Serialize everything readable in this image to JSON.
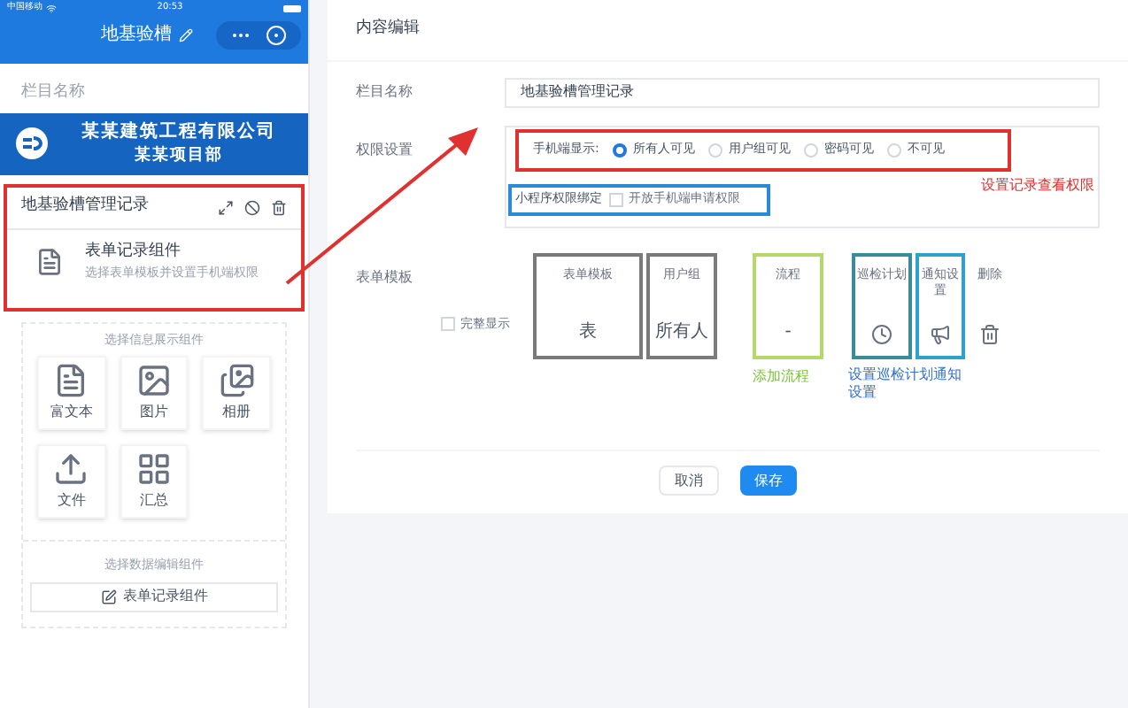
{
  "phone": {
    "carrier": "中国移动",
    "time": "20:53",
    "title": "地基验槽",
    "section_label": "栏目名称",
    "banner": {
      "company": "某某建筑工程有限公司",
      "department": "某某项目部"
    },
    "card": {
      "title": "地基验槽管理记录",
      "item_title": "表单记录组件",
      "item_subtitle": "选择表单模板并设置手机端权限"
    },
    "info_label": "选择信息展示组件",
    "widgets": [
      {
        "label": "富文本",
        "kind": "doc"
      },
      {
        "label": "图片",
        "kind": "image"
      },
      {
        "label": "相册",
        "kind": "album"
      },
      {
        "label": "文件",
        "kind": "upload"
      },
      {
        "label": "汇总",
        "kind": "grid"
      }
    ],
    "edit_label": "选择数据编辑组件",
    "edit_button": "表单记录组件"
  },
  "editor": {
    "title": "内容编辑",
    "name_label": "栏目名称",
    "name_value": "地基验槽管理记录",
    "permission_label": "权限设置",
    "display_label": "手机端显示:",
    "radios": [
      {
        "label": "所有人可见",
        "selected": true
      },
      {
        "label": "用户组可见",
        "selected": false
      },
      {
        "label": "密码可见",
        "selected": false
      },
      {
        "label": "不可见",
        "selected": false
      }
    ],
    "permission_note": "设置记录查看权限",
    "bind_label": "小程序权限绑定",
    "bind_option": {
      "label": "开放手机端申请权限",
      "checked": false
    },
    "form_label": "表单模板",
    "full_display": {
      "label": "完整显示",
      "checked": false
    },
    "columns": [
      {
        "label": "表单模板",
        "color": "#7a7a7a",
        "cell": {
          "kind": "text",
          "text": "表"
        }
      },
      {
        "label": "用户组",
        "color": "#7a7a7a",
        "cell": {
          "kind": "text",
          "text": "所有人"
        }
      },
      {
        "label": "流程",
        "color": "#b5d86a",
        "cell": {
          "kind": "text",
          "text": "-"
        }
      },
      {
        "label": "巡检计划",
        "color": "#3a8c9a",
        "cell": {
          "kind": "clock"
        }
      },
      {
        "label": "通知设置",
        "color": "#2fa3c7",
        "cell": {
          "kind": "megaphone"
        }
      },
      {
        "label": "删除",
        "cell": {
          "kind": "trash"
        }
      }
    ],
    "notes": [
      {
        "text": "添加流程",
        "color": "#7cc23a"
      },
      {
        "text": "设置巡检计划通知设置",
        "color": "#2f6fd0"
      }
    ],
    "buttons": [
      {
        "label": "取消",
        "kind": "secondary"
      },
      {
        "label": "保存",
        "kind": "primary"
      }
    ]
  }
}
